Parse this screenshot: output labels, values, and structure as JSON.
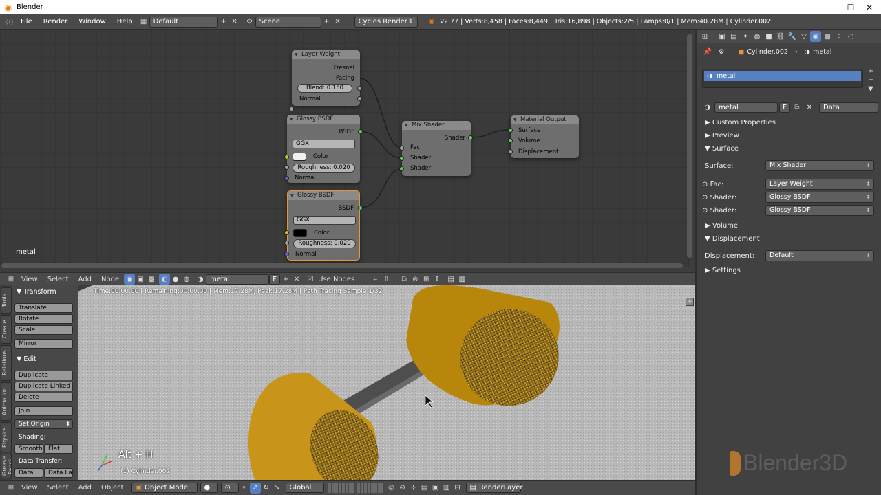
{
  "titlebar": {
    "title": "Blender"
  },
  "infobar": {
    "menus": [
      "File",
      "Render",
      "Window",
      "Help"
    ],
    "layout": "Default",
    "scene": "Scene",
    "engine": "Cycles Render",
    "stats": "v2.77 | Verts:8,458 | Faces:8,449 | Tris:16,898 | Objects:2/5 | Lamps:0/1 | Mem:40.28M | Cylinder.002"
  },
  "node_editor": {
    "material_label": "metal",
    "nodes": {
      "layer_weight": {
        "title": "Layer Weight",
        "out1": "Fresnel",
        "out2": "Facing",
        "blend": "Blend:",
        "blend_val": "0.150",
        "normal": "Normal"
      },
      "glossy1": {
        "title": "Glossy BSDF",
        "out": "BSDF",
        "dist": "GGX",
        "color": "Color",
        "roughness": "Roughness:",
        "roughness_val": "0.020",
        "normal": "Normal",
        "swatch": "#f0f0f0"
      },
      "glossy2": {
        "title": "Glossy BSDF",
        "out": "BSDF",
        "dist": "GGX",
        "color": "Color",
        "roughness": "Roughness:",
        "roughness_val": "0.020",
        "normal": "Normal",
        "swatch": "#000000"
      },
      "mix": {
        "title": "Mix Shader",
        "out": "Shader",
        "fac": "Fac",
        "in1": "Shader",
        "in2": "Shader"
      },
      "output": {
        "title": "Material Output",
        "surface": "Surface",
        "volume": "Volume",
        "displacement": "Displacement"
      }
    }
  },
  "ne_header": {
    "menus": [
      "View",
      "Select",
      "Add",
      "Node"
    ],
    "material": "metal",
    "fake_user": "F",
    "use_nodes": "Use Nodes"
  },
  "viewport": {
    "render_status": "Time:00:00.00 | Remaining:00:00.00 | Mem:17.28M, Peak:17.28M | Path Tracing Sample 1/32",
    "hotkey": "Alt + H",
    "object_label": "(1) Cylinder.002",
    "watermark": "Blender3D"
  },
  "vtabs": [
    "Tools",
    "Create",
    "Relations",
    "Animation",
    "Physics",
    "Grease Pencil"
  ],
  "toolshelf": {
    "transform": "Transform",
    "translate": "Translate",
    "rotate": "Rotate",
    "scale": "Scale",
    "mirror": "Mirror",
    "edit": "Edit",
    "duplicate": "Duplicate",
    "duplicate_linked": "Duplicate Linked",
    "delete": "Delete",
    "join": "Join",
    "set_origin": "Set Origin",
    "shading": "Shading:",
    "smooth": "Smooth",
    "flat": "Flat",
    "data_transfer": "Data Transfer:",
    "data": "Data",
    "data_la": "Data La"
  },
  "vp_header": {
    "menus": [
      "View",
      "Select",
      "Add",
      "Object"
    ],
    "mode": "Object Mode",
    "orientation": "Global",
    "render_layer": "RenderLayer"
  },
  "properties": {
    "breadcrumb_object": "Cylinder.002",
    "breadcrumb_material": "metal",
    "slot": "metal",
    "material_name": "metal",
    "fake_user": "F",
    "link": "Data",
    "sections": {
      "custom": "Custom Properties",
      "preview": "Preview",
      "surface": "Surface",
      "volume": "Volume",
      "displacement": "Displacement",
      "settings": "Settings"
    },
    "surface_label": "Surface:",
    "surface_val": "Mix Shader",
    "fac_label": "Fac:",
    "fac_val": "Layer Weight",
    "shader1_label": "Shader:",
    "shader1_val": "Glossy BSDF",
    "shader2_label": "Shader:",
    "shader2_val": "Glossy BSDF",
    "disp_label": "Displacement:",
    "disp_val": "Default"
  }
}
